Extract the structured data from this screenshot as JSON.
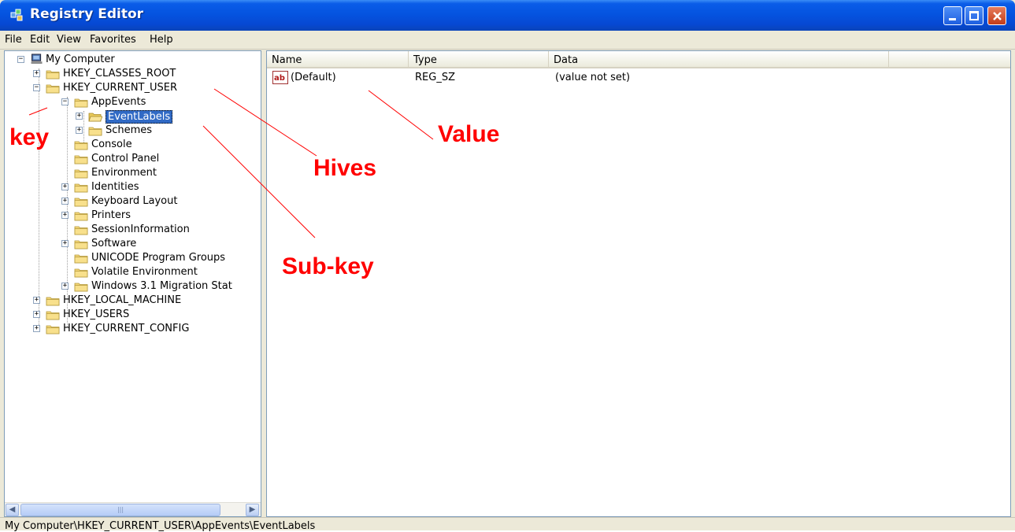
{
  "window": {
    "title": "Registry Editor",
    "icon": "registry-editor-icon"
  },
  "menu": [
    "File",
    "Edit",
    "View",
    "Favorites",
    "Help"
  ],
  "tree": {
    "root": "My Computer",
    "nodes": [
      {
        "label": "HKEY_CLASSES_ROOT",
        "expander": "+"
      },
      {
        "label": "HKEY_CURRENT_USER",
        "expander": "−"
      },
      {
        "label": "AppEvents",
        "expander": "−"
      },
      {
        "label": "EventLabels",
        "expander": "+"
      },
      {
        "label": "Schemes",
        "expander": "+"
      },
      {
        "label": "Console",
        "expander": ""
      },
      {
        "label": "Control Panel",
        "expander": ""
      },
      {
        "label": "Environment",
        "expander": ""
      },
      {
        "label": "Identities",
        "expander": "+"
      },
      {
        "label": "Keyboard Layout",
        "expander": "+"
      },
      {
        "label": "Printers",
        "expander": "+"
      },
      {
        "label": "SessionInformation",
        "expander": ""
      },
      {
        "label": "Software",
        "expander": "+"
      },
      {
        "label": "UNICODE Program Groups",
        "expander": ""
      },
      {
        "label": "Volatile Environment",
        "expander": ""
      },
      {
        "label": "Windows 3.1 Migration Stat",
        "expander": "+"
      },
      {
        "label": "HKEY_LOCAL_MACHINE",
        "expander": "+"
      },
      {
        "label": "HKEY_USERS",
        "expander": "+"
      },
      {
        "label": "HKEY_CURRENT_CONFIG",
        "expander": "+"
      }
    ],
    "selected": "EventLabels"
  },
  "list": {
    "columns": [
      "Name",
      "Type",
      "Data"
    ],
    "rows": [
      {
        "name": "(Default)",
        "type": "REG_SZ",
        "data": "(value not set)",
        "icon": "string-value-icon"
      }
    ]
  },
  "status": "My Computer\\HKEY_CURRENT_USER\\AppEvents\\EventLabels",
  "annotations": {
    "key": "key",
    "hives": "Hives",
    "value": "Value",
    "subkey": "Sub-key",
    "color": "#ff0000"
  }
}
